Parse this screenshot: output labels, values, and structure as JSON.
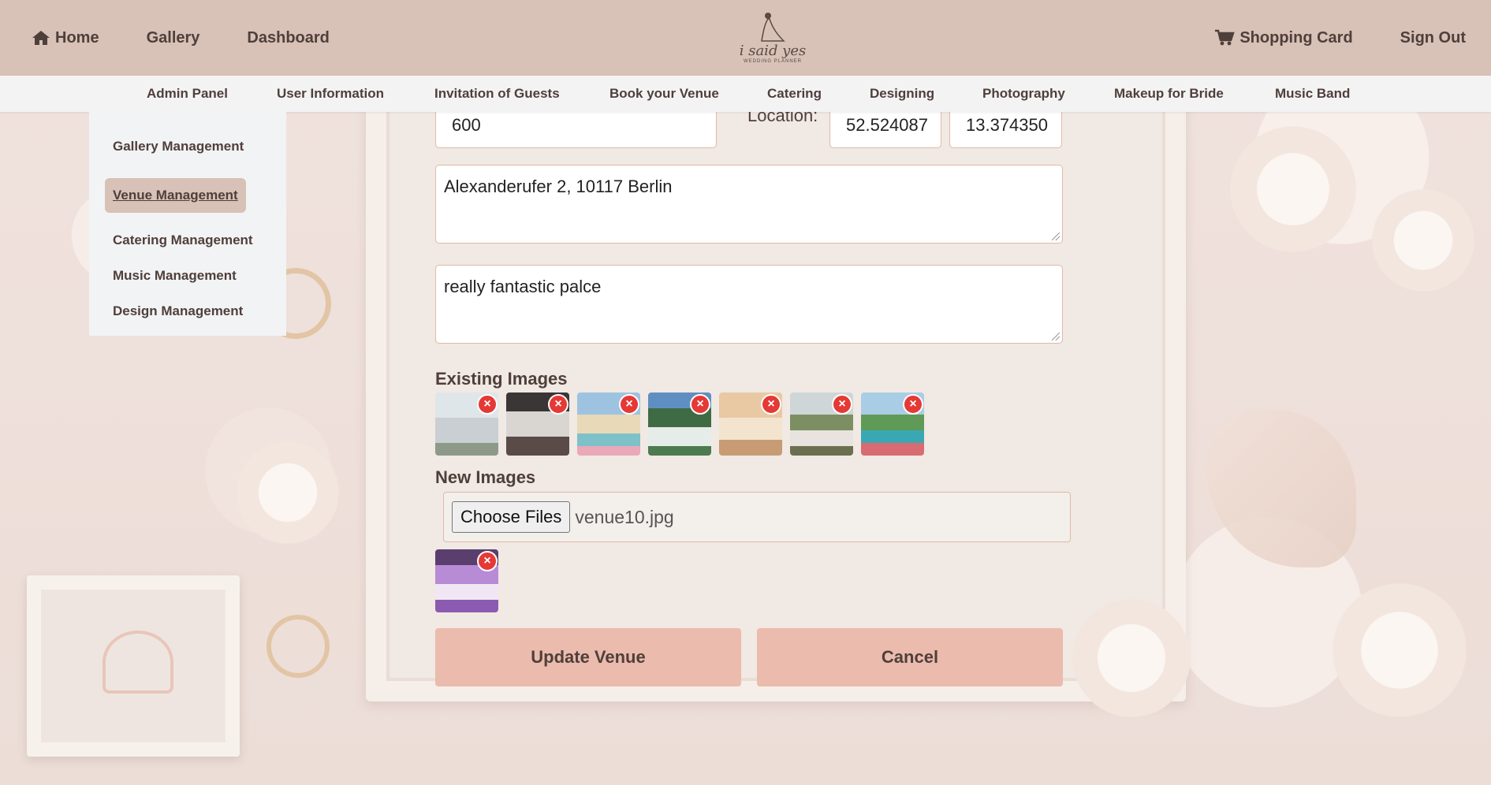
{
  "header": {
    "home_label": "Home",
    "gallery_label": "Gallery",
    "dashboard_label": "Dashboard",
    "logo_script": "i said yes",
    "logo_sub": "WEDDING PLANNER",
    "cart_label": "Shopping Card",
    "signout_label": "Sign Out"
  },
  "subnav": {
    "items": [
      "Admin Panel",
      "User Information",
      "Invitation of Guests",
      "Book your Venue",
      "Catering",
      "Designing",
      "Photography",
      "Makeup for Bride",
      "Music Band"
    ]
  },
  "dropdown": {
    "items": [
      "Gallery Management",
      "Venue Management",
      "Catering Management",
      "Music Management",
      "Design Management"
    ],
    "active_index": 1
  },
  "form": {
    "capacity_value": "600",
    "location_label": "Location:",
    "latitude_value": "52.524087",
    "longitude_value": "13.374350",
    "address_value": "Alexanderufer 2, 10117 Berlin",
    "description_value": "really fantastic palce",
    "existing_images_label": "Existing Images",
    "new_images_label": "New Images",
    "choose_files_label": "Choose Files",
    "chosen_file": "venue10.jpg",
    "delete_symbol": "×",
    "update_label": "Update Venue",
    "cancel_label": "Cancel"
  },
  "colors": {
    "header_bg": "#d8c1b6",
    "subnav_bg": "#f3f3f4",
    "button_bg": "#ebbbad",
    "delete_badge": "#e53935"
  },
  "existing_image_count": 7,
  "new_image_count": 1
}
